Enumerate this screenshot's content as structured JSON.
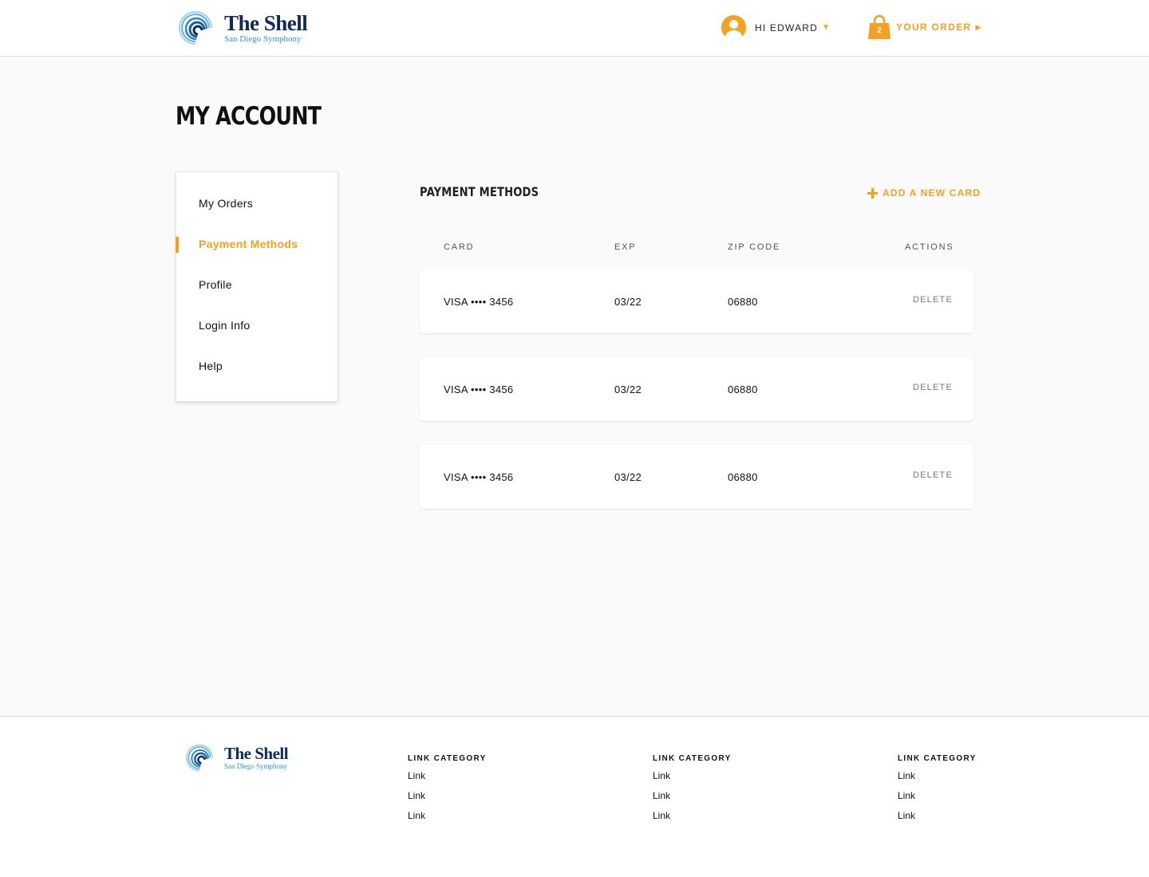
{
  "brand": {
    "name": "The Shell",
    "subtitle": "San Diego Symphony"
  },
  "header": {
    "user_greeting": "HI EDWARD",
    "order_label": "YOUR ORDER",
    "order_count": "2"
  },
  "page": {
    "title": "MY ACCOUNT"
  },
  "sidebar": {
    "items": [
      {
        "label": "My Orders",
        "active": false
      },
      {
        "label": "Payment Methods",
        "active": true
      },
      {
        "label": "Profile",
        "active": false
      },
      {
        "label": "Login Info",
        "active": false
      },
      {
        "label": "Help",
        "active": false
      }
    ]
  },
  "payments": {
    "title": "PAYMENT METHODS",
    "add_label": "ADD A NEW CARD",
    "columns": [
      "CARD",
      "EXP",
      "ZIP CODE",
      "ACTIONS"
    ],
    "rows": [
      {
        "card": "VISA •••• 3456",
        "exp": "03/22",
        "zip": "06880",
        "action": "DELETE"
      },
      {
        "card": "VISA •••• 3456",
        "exp": "03/22",
        "zip": "06880",
        "action": "DELETE"
      },
      {
        "card": "VISA •••• 3456",
        "exp": "03/22",
        "zip": "06880",
        "action": "DELETE"
      }
    ]
  },
  "footer": {
    "columns": [
      {
        "category": "LINK CATEGORY",
        "links": [
          "Link",
          "Link",
          "Link"
        ]
      },
      {
        "category": "LINK CATEGORY",
        "links": [
          "Link",
          "Link",
          "Link"
        ]
      },
      {
        "category": "LINK CATEGORY",
        "links": [
          "Link",
          "Link",
          "Link"
        ]
      }
    ]
  },
  "colors": {
    "accent": "#f5a020",
    "brand_navy": "#0e2a57",
    "brand_blue": "#3a8fc8",
    "page_bg": "#fafafa"
  }
}
